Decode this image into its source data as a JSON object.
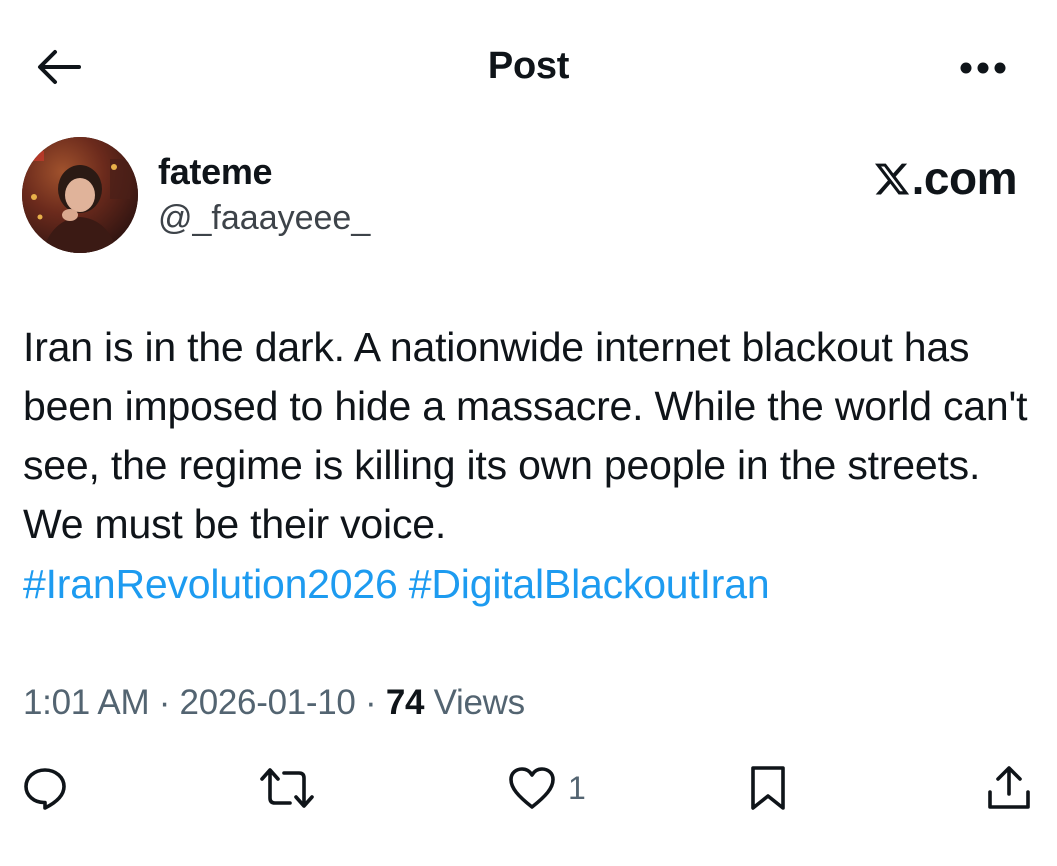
{
  "header": {
    "title": "Post",
    "back_icon": "arrow-left-icon",
    "more_icon": "more-horizontal-icon"
  },
  "author": {
    "display_name": "fateme",
    "handle": "@_faaayeee_",
    "avatar_icon": "avatar"
  },
  "watermark": {
    "x_glyph": "X",
    "suffix": ".com"
  },
  "post": {
    "text": "Iran is in the dark. A nationwide internet blackout has been imposed to hide a massacre. While the world can't see, the regime is killing its own people in the streets. We must be their voice.",
    "hashtags": [
      "#IranRevolution2026",
      "#DigitalBlackoutIran"
    ]
  },
  "meta": {
    "time": "1:01 AM",
    "sep1": " · ",
    "date": "2026-01-10",
    "sep2": " · ",
    "views_count": "74",
    "views_label": " Views"
  },
  "actions": {
    "reply_icon": "reply-icon",
    "repost_icon": "repost-icon",
    "like_icon": "heart-icon",
    "like_count": "1",
    "bookmark_icon": "bookmark-icon",
    "share_icon": "share-icon"
  },
  "colors": {
    "text": "#0f1419",
    "secondary": "#536471",
    "link": "#1d9bf0",
    "background": "#ffffff"
  }
}
